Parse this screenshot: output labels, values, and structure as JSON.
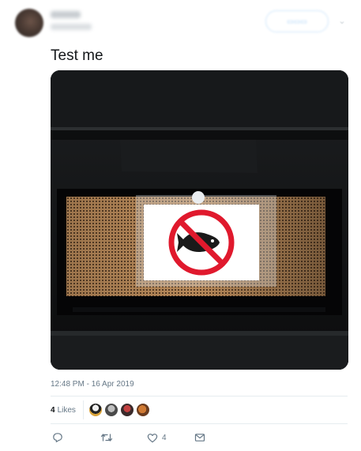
{
  "tweet": {
    "text": "Test me",
    "timestamp": "12:48 PM - 16 Apr 2019"
  },
  "likes": {
    "count": "4",
    "label": "Likes"
  },
  "actions": {
    "like_count": "4"
  },
  "icons": {
    "reply": "reply-icon",
    "retweet": "retweet-icon",
    "like": "heart-icon",
    "dm": "envelope-icon",
    "more": "chevron-down-icon",
    "photo_sign": "no-fish-icon"
  },
  "colors": {
    "text": "#14171a",
    "muted": "#657786",
    "divider": "#e6ecf0",
    "follow_outline": "#cfe6fb",
    "prohibition_red": "#e0192d"
  }
}
